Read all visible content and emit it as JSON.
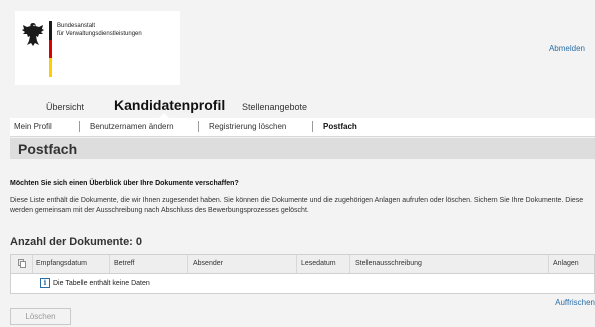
{
  "brand": {
    "agency_line1": "Bundesanstalt",
    "agency_line2": "für Verwaltungsdienstleistungen",
    "flag_colors": [
      "#1a1a1a",
      "#dd0000",
      "#ffce00"
    ]
  },
  "header": {
    "logout_label": "Abmelden"
  },
  "main_tabs": [
    {
      "label": "Übersicht",
      "active": false
    },
    {
      "label": "Kandidatenprofil",
      "active": true
    },
    {
      "label": "Stellenangebote",
      "active": false
    }
  ],
  "sub_nav": [
    {
      "label": "Mein Profil",
      "active": false
    },
    {
      "label": "Benutzernamen ändern",
      "active": false
    },
    {
      "label": "Registrierung löschen",
      "active": false
    },
    {
      "label": "Postfach",
      "active": true
    }
  ],
  "page": {
    "title": "Postfach",
    "question": "Möchten Sie sich einen Überblick über Ihre Dokumente verschaffen?",
    "description": "Diese Liste enthält die Dokumente, die wir Ihnen zugesendet haben. Sie können die Dokumente und die zugehörigen Anlagen aufrufen oder löschen. Sichern Sie Ihre Dokumente. Diese werden gemeinsam mit der Ausschreibung nach Abschluss des Bewerbungsprozesses gelöscht.",
    "count_heading": "Anzahl der Dokumente: 0"
  },
  "table": {
    "columns": [
      "Empfangsdatum",
      "Betreff",
      "Absender",
      "Lesedatum",
      "Stellenausschreibung",
      "Anlagen"
    ],
    "empty_message": "Die Tabelle enthält keine Daten",
    "info_icon": "i"
  },
  "actions": {
    "refresh_label": "Auffrischen",
    "delete_label": "Löschen"
  },
  "colors": {
    "link": "#2a6ea6",
    "background": "#f3f3f3",
    "heading_bar": "#dddddd"
  }
}
